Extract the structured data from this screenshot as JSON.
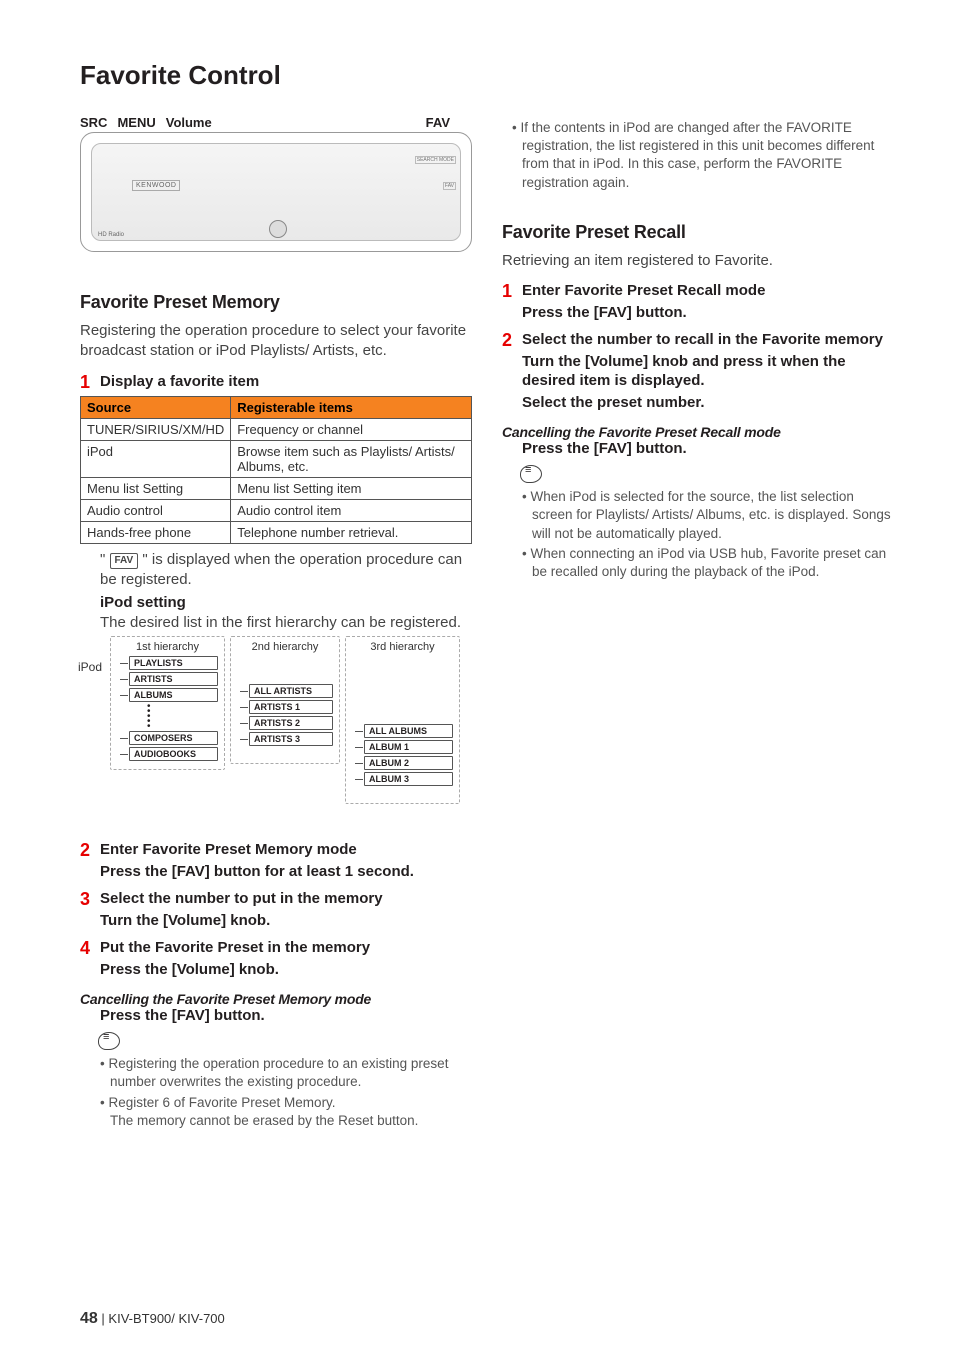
{
  "title": "Favorite Control",
  "panel_labels": {
    "src": "SRC",
    "menu": "MENU",
    "volume": "Volume",
    "fav": "FAV"
  },
  "panel": {
    "logo": "KENWOOD",
    "hd": "HD Radio",
    "search": "SEARCH MODE",
    "fav_btn": "FAV"
  },
  "section_memory": {
    "heading": "Favorite Preset Memory",
    "intro": "Registering the operation procedure to select your favorite broadcast station or iPod Playlists/ Artists, etc.",
    "step1_title": "Display a favorite item",
    "table": {
      "h1": "Source",
      "h2": "Registerable items",
      "rows": [
        {
          "c1": "TUNER/SIRIUS/XM/HD",
          "c2": "Frequency or channel"
        },
        {
          "c1": "iPod",
          "c2": "Browse item such as Playlists/ Artists/ Albums, etc."
        },
        {
          "c1": "Menu list Setting",
          "c2": "Menu list Setting item"
        },
        {
          "c1": "Audio control",
          "c2": "Audio control item"
        },
        {
          "c1": "Hands-free phone",
          "c2": "Telephone number retrieval."
        }
      ]
    },
    "fav_chip": "FAV",
    "fav_note_a": "\" ",
    "fav_note_b": " \" is displayed when the operation procedure can be registered.",
    "ipod_setting_h": "iPod setting",
    "ipod_setting_p": "The desired list in the first hierarchy can be registered.",
    "hier": {
      "ipod": "iPod",
      "h1": "1st hierarchy",
      "h2": "2nd hierarchy",
      "h3": "3rd hierarchy",
      "col1": [
        "PLAYLISTS",
        "ARTISTS",
        "ALBUMS",
        "COMPOSERS",
        "AUDIOBOOKS"
      ],
      "col2": [
        "ALL ARTISTS",
        "ARTISTS 1",
        "ARTISTS 2",
        "ARTISTS 3"
      ],
      "col3": [
        "ALL ALBUMS",
        "ALBUM 1",
        "ALBUM 2",
        "ALBUM 3"
      ]
    },
    "step2_title": "Enter Favorite Preset Memory mode",
    "step2_sub": "Press the [FAV] button for at least 1 second.",
    "step3_title": "Select the number to put in the memory",
    "step3_sub": "Turn the [Volume] knob.",
    "step4_title": "Put the Favorite Preset in the memory",
    "step4_sub": "Press the [Volume] knob.",
    "cancel_h": "Cancelling the Favorite Preset Memory mode",
    "cancel_sub": "Press the [FAV] button.",
    "notes": [
      "Registering the operation procedure to an existing preset number overwrites the existing procedure.",
      "Register 6 of Favorite Preset Memory.\nThe memory cannot be erased by the Reset button."
    ]
  },
  "col2_top_note": "If the contents in iPod are changed after the FAVORITE registration, the list registered in this unit becomes different from that in iPod. In this case, perform the FAVORITE registration again.",
  "section_recall": {
    "heading": "Favorite Preset Recall",
    "intro": "Retrieving an item registered to Favorite.",
    "step1_title": "Enter Favorite Preset Recall mode",
    "step1_sub": "Press the [FAV] button.",
    "step2_title": "Select the number to recall in the Favorite memory",
    "step2_sub1": "Turn the [Volume] knob and press it when the desired item is displayed.",
    "step2_sub2": "Select the preset number.",
    "cancel_h": "Cancelling the Favorite Preset Recall mode",
    "cancel_sub": "Press the [FAV] button.",
    "notes": [
      "When iPod is selected for the source, the list selection screen for Playlists/ Artists/ Albums, etc. is displayed. Songs will not be automatically played.",
      "When connecting an iPod via USB hub, Favorite preset can be recalled only during the playback of the iPod."
    ]
  },
  "footer": {
    "page": "48",
    "sep": "   |   ",
    "model": "KIV-BT900/ KIV-700"
  }
}
